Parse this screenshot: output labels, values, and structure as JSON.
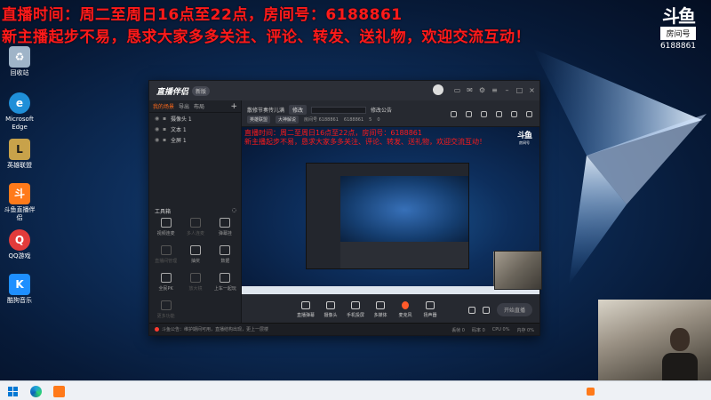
{
  "overlay": {
    "line1": "直播时间：周二至周日16点至22点，房间号：6188861",
    "line2": "新主播起步不易，恳求大家多多关注、评论、转发、送礼物，欢迎交流互动！"
  },
  "douyu_badge": {
    "logo": "斗鱼",
    "room_label": "房间号",
    "room_id": "6188861"
  },
  "desktop_icons": [
    {
      "label": "回收站",
      "icon": "recycle-bin-icon",
      "color": "#9fb4c8"
    },
    {
      "label": "Microsoft Edge",
      "icon": "edge-icon",
      "color": "#1f8fd8"
    },
    {
      "label": "英雄联盟",
      "icon": "league-icon",
      "color": "#c8a24a"
    },
    {
      "label": "斗鱼直播伴侣",
      "icon": "douyu-companion-icon",
      "color": "#ff7a1a"
    },
    {
      "label": "QQ游戏",
      "icon": "qq-game-icon",
      "color": "#e23b3b"
    },
    {
      "label": "酷狗音乐",
      "icon": "kugou-icon",
      "color": "#1e8fff"
    }
  ],
  "app": {
    "name": "直播伴侣",
    "version_badge": "新版",
    "left_tabs": [
      "我的场景",
      "导出",
      "布局"
    ],
    "scenes": [
      "摄像头 1",
      "文本 1",
      "全屏 1"
    ],
    "tools_title": "工具箱",
    "tools": [
      {
        "label": "视频连麦",
        "dim": false
      },
      {
        "label": "多人连麦",
        "dim": true
      },
      {
        "label": "弹幕挂",
        "dim": false
      },
      {
        "label": "直播间管理",
        "dim": true
      },
      {
        "label": "抽奖",
        "dim": false
      },
      {
        "label": "数据",
        "dim": false
      },
      {
        "label": "全民PK",
        "dim": false
      },
      {
        "label": "放大镜",
        "dim": true
      },
      {
        "label": "上车一起玩",
        "dim": false
      },
      {
        "label": "更多功能",
        "dim": true
      }
    ],
    "info": {
      "room_title": "散修节奏传儿满",
      "category_btn": "修改",
      "announcement": "修改公告",
      "tag1": "英雄联盟",
      "tag2": "大神解说",
      "room_no": "房间号 6188861",
      "fans": "6188861",
      "viewers": "5",
      "gifts": "0"
    },
    "preview": {
      "line1": "直播时间：周二至周日16点至22点，房间号：6188861",
      "line2": "新主播起步不易，恳求大家多多关注、评论、转发、送礼物，欢迎交流互动！",
      "douyu_logo": "斗鱼",
      "room_label": "房间号"
    },
    "bottom_tools": [
      "直播弹幕",
      "摄像头",
      "手机投屏",
      "多媒体",
      "麦克风",
      "扬声器"
    ],
    "start_live": "开始直播",
    "status_text": "斗鱼公告：维护期间可用，直播结构出现，更上一层楼",
    "status_stats": [
      "丢帧 0",
      "码率 0",
      "CPU 0%",
      "内存 0%"
    ]
  },
  "taskbar": {
    "items": [
      "start",
      "edge",
      "douyu-companion",
      "tray-douyu"
    ]
  }
}
